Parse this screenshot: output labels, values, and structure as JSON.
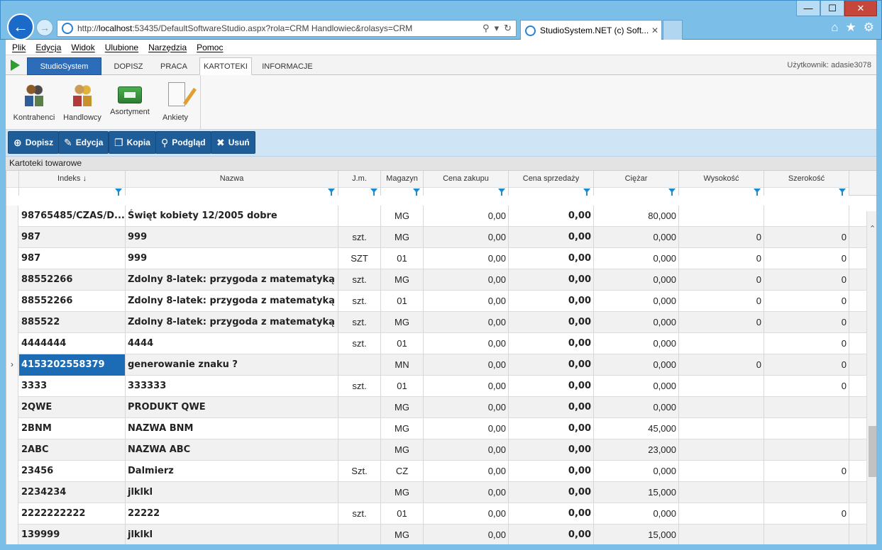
{
  "browser": {
    "address_prefix": "http://",
    "address_host": "localhost",
    "address_rest": ":53435/DefaultSoftwareStudio.aspx?rola=CRM Handlowiec&rolasys=CRM",
    "tab_title": "StudioSystem.NET (c) Soft...",
    "tab_close": "✕",
    "window_buttons": [
      "—",
      "☐",
      "✕"
    ]
  },
  "menu": [
    "Plik",
    "Edycja",
    "Widok",
    "Ulubione",
    "Narzędzia",
    "Pomoc"
  ],
  "app_tabs": {
    "home": "StudioSystem",
    "tabs": [
      "DOPISZ",
      "PRACA",
      "KARTOTEKI",
      "INFORMACJE"
    ],
    "active": "KARTOTEKI",
    "user": "Użytkownik: adasie3078"
  },
  "ribbon": [
    {
      "label": "Kontrahenci",
      "icon": "contractors-icon"
    },
    {
      "label": "Handlowcy",
      "icon": "salespeople-icon"
    },
    {
      "label": "Asortyment",
      "icon": "assortment-icon"
    },
    {
      "label": "Ankiety",
      "icon": "surveys-icon"
    }
  ],
  "toolbar": {
    "add": "Dopisz",
    "edit": "Edycja",
    "copy": "Kopia",
    "preview": "Podgląd",
    "delete": "Usuń"
  },
  "section_title": "Kartoteki towarowe",
  "grid": {
    "columns": [
      "Indeks ↓",
      "Nazwa",
      "J.m.",
      "Magazyn",
      "Cena zakupu",
      "Cena sprzedaży",
      "Ciężar",
      "Wysokość",
      "Szerokość"
    ],
    "rows": [
      [
        "98765485/CZAS/D...",
        "Święt kobiety 12/2005 dobre",
        "",
        "MG",
        "0,00",
        "0,00",
        "80,000",
        "",
        ""
      ],
      [
        "987",
        "999",
        "szt.",
        "MG",
        "0,00",
        "0,00",
        "0,000",
        "0",
        "0"
      ],
      [
        "987",
        "999",
        "SZT",
        "01",
        "0,00",
        "0,00",
        "0,000",
        "0",
        "0"
      ],
      [
        "88552266",
        "Zdolny 8-latek: przygoda z matematyką",
        "szt.",
        "MG",
        "0,00",
        "0,00",
        "0,000",
        "0",
        "0"
      ],
      [
        "88552266",
        "Zdolny 8-latek: przygoda z matematyką",
        "szt.",
        "01",
        "0,00",
        "0,00",
        "0,000",
        "0",
        "0"
      ],
      [
        "885522",
        "Zdolny 8-latek: przygoda z matematyką",
        "szt.",
        "MG",
        "0,00",
        "0,00",
        "0,000",
        "0",
        "0"
      ],
      [
        "4444444",
        "4444",
        "szt.",
        "01",
        "0,00",
        "0,00",
        "0,000",
        "",
        "0"
      ],
      [
        "4153202558379",
        "generowanie znaku ?",
        "",
        "MN",
        "0,00",
        "0,00",
        "0,000",
        "0",
        "0"
      ],
      [
        "3333",
        "333333",
        "szt.",
        "01",
        "0,00",
        "0,00",
        "0,000",
        "",
        "0"
      ],
      [
        "2QWE",
        "PRODUKT QWE",
        "",
        "MG",
        "0,00",
        "0,00",
        "0,000",
        "",
        ""
      ],
      [
        "2BNM",
        "NAZWA BNM",
        "",
        "MG",
        "0,00",
        "0,00",
        "45,000",
        "",
        ""
      ],
      [
        "2ABC",
        "NAZWA ABC",
        "",
        "MG",
        "0,00",
        "0,00",
        "23,000",
        "",
        ""
      ],
      [
        "23456",
        "Dalmierz",
        "Szt.",
        "CZ",
        "0,00",
        "0,00",
        "0,000",
        "",
        "0"
      ],
      [
        "2234234",
        "jlklkl",
        "",
        "MG",
        "0,00",
        "0,00",
        "15,000",
        "",
        ""
      ],
      [
        "2222222222",
        "22222",
        "szt.",
        "01",
        "0,00",
        "0,00",
        "0,000",
        "",
        "0"
      ],
      [
        "139999",
        "jlklkl",
        "",
        "MG",
        "0,00",
        "0,00",
        "15,000",
        "",
        ""
      ]
    ],
    "selected_row": 7,
    "current_row_marker": "›"
  }
}
